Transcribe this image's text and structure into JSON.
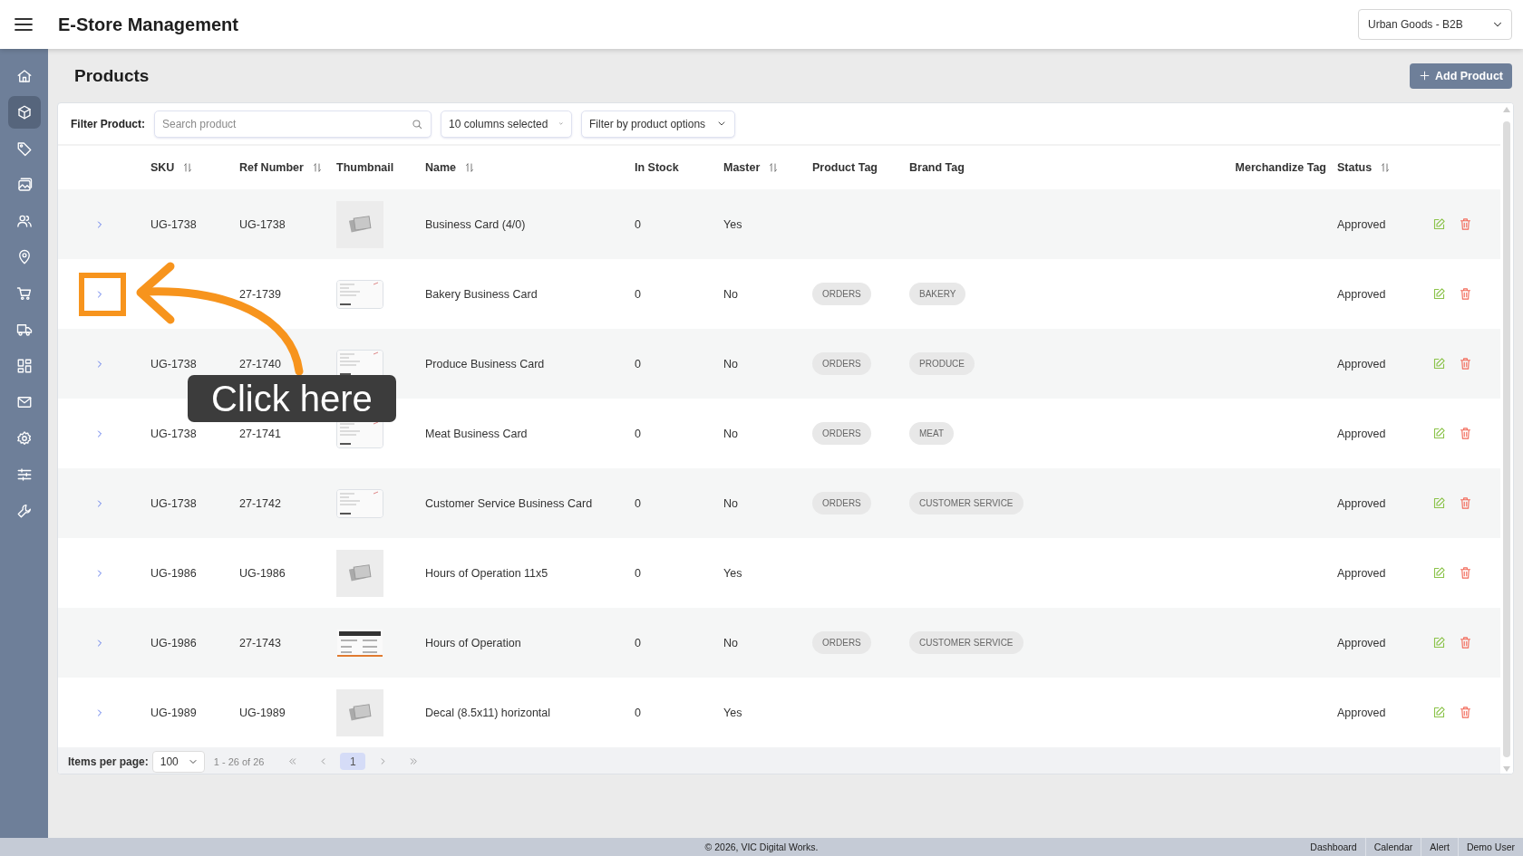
{
  "header": {
    "title": "E-Store Management",
    "store_select": "Urban Goods - B2B"
  },
  "sidebar": {
    "items": [
      {
        "kind": "home",
        "selected": false
      },
      {
        "kind": "box",
        "selected": true
      },
      {
        "kind": "tag",
        "selected": false
      },
      {
        "kind": "image",
        "selected": false
      },
      {
        "kind": "users",
        "selected": false
      },
      {
        "kind": "pin",
        "selected": false
      },
      {
        "kind": "cart",
        "selected": false
      },
      {
        "kind": "truck",
        "selected": false
      },
      {
        "kind": "grid",
        "selected": false
      },
      {
        "kind": "mail",
        "selected": false
      },
      {
        "kind": "gear",
        "selected": false
      },
      {
        "kind": "sliders",
        "selected": false
      },
      {
        "kind": "wrench",
        "selected": false
      }
    ]
  },
  "page": {
    "title": "Products",
    "add_button": "Add Product"
  },
  "filter": {
    "label": "Filter Product:",
    "search_placeholder": "Search product",
    "columns_select": "10 columns selected",
    "options_select": "Filter by product options"
  },
  "table": {
    "columns": [
      {
        "label": "SKU",
        "sortable": true
      },
      {
        "label": "Ref Number",
        "sortable": true
      },
      {
        "label": "Thumbnail",
        "sortable": false
      },
      {
        "label": "Name",
        "sortable": true
      },
      {
        "label": "In Stock",
        "sortable": false
      },
      {
        "label": "Master",
        "sortable": true
      },
      {
        "label": "Product Tag",
        "sortable": false
      },
      {
        "label": "Brand Tag",
        "sortable": false
      },
      {
        "label": "Merchandize Tag",
        "sortable": false
      },
      {
        "label": "Status",
        "sortable": true
      }
    ],
    "rows": [
      {
        "sku": "UG-1738",
        "ref": "UG-1738",
        "thumbnail": {
          "kind": "placeholder"
        },
        "name": "Business Card (4/0)",
        "in_stock": "0",
        "master": "Yes",
        "status": "Approved"
      },
      {
        "ref": "27-1739",
        "thumbnail": {
          "kind": "card"
        },
        "name": "Bakery Business Card",
        "in_stock": "0",
        "master": "No",
        "product_tag": "ORDERS",
        "brand_tag": "BAKERY",
        "status": "Approved"
      },
      {
        "sku": "UG-1738",
        "ref": "27-1740",
        "thumbnail": {
          "kind": "card"
        },
        "name": "Produce Business Card",
        "in_stock": "0",
        "master": "No",
        "product_tag": "ORDERS",
        "brand_tag": "PRODUCE",
        "status": "Approved"
      },
      {
        "sku": "UG-1738",
        "ref": "27-1741",
        "thumbnail": {
          "kind": "card"
        },
        "name": "Meat Business Card",
        "in_stock": "0",
        "master": "No",
        "product_tag": "ORDERS",
        "brand_tag": "MEAT",
        "status": "Approved"
      },
      {
        "sku": "UG-1738",
        "ref": "27-1742",
        "thumbnail": {
          "kind": "card"
        },
        "name": "Customer Service Business Card",
        "in_stock": "0",
        "master": "No",
        "product_tag": "ORDERS",
        "brand_tag": "CUSTOMER SERVICE",
        "status": "Approved"
      },
      {
        "sku": "UG-1986",
        "ref": "UG-1986",
        "thumbnail": {
          "kind": "placeholder"
        },
        "name": "Hours of Operation 11x5",
        "in_stock": "0",
        "master": "Yes",
        "status": "Approved"
      },
      {
        "sku": "UG-1986",
        "ref": "27-1743",
        "thumbnail": {
          "kind": "sign"
        },
        "name": "Hours of Operation",
        "in_stock": "0",
        "master": "No",
        "product_tag": "ORDERS",
        "brand_tag": "CUSTOMER SERVICE",
        "status": "Approved"
      },
      {
        "sku": "UG-1989",
        "ref": "UG-1989",
        "thumbnail": {
          "kind": "placeholder"
        },
        "name": "Decal (8.5x11) horizontal",
        "in_stock": "0",
        "master": "Yes",
        "status": "Approved"
      }
    ]
  },
  "pagination": {
    "label": "Items per page:",
    "per_page": "100",
    "range": "1 - 26 of 26",
    "pages": [
      {
        "label": "1",
        "selected": true
      }
    ]
  },
  "footer": {
    "copyright": "© 2026, VIC Digital Works.",
    "links": [
      "Dashboard",
      "Calendar",
      "Alert",
      "Demo User"
    ]
  },
  "annotation": {
    "text": "Click here"
  }
}
